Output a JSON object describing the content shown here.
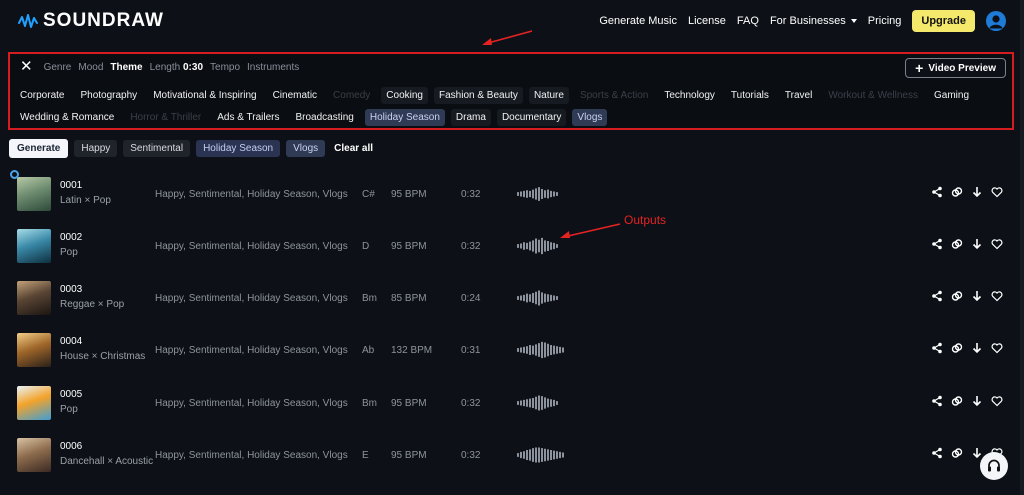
{
  "app": {
    "logo_text": "SOUNDRAW"
  },
  "nav": {
    "items": [
      {
        "label": "Generate Music"
      },
      {
        "label": "License"
      },
      {
        "label": "FAQ"
      },
      {
        "label": "For Businesses"
      },
      {
        "label": "Pricing"
      }
    ],
    "upgrade_label": "Upgrade"
  },
  "filters": {
    "tabs": [
      {
        "label": "Genre"
      },
      {
        "label": "Mood"
      },
      {
        "label": "Theme",
        "active": true
      },
      {
        "label": "Length",
        "value": "0:30"
      },
      {
        "label": "Tempo"
      },
      {
        "label": "Instruments"
      }
    ],
    "video_preview_label": "Video Preview",
    "theme_row_1": [
      {
        "label": "Corporate",
        "state": "normal"
      },
      {
        "label": "Photography",
        "state": "normal"
      },
      {
        "label": "Motivational & Inspiring",
        "state": "normal"
      },
      {
        "label": "Cinematic",
        "state": "normal"
      },
      {
        "label": "Comedy",
        "state": "disabled"
      },
      {
        "label": "Cooking",
        "state": "dark"
      },
      {
        "label": "Fashion & Beauty",
        "state": "dark"
      },
      {
        "label": "Nature",
        "state": "dark"
      },
      {
        "label": "Sports & Action",
        "state": "disabled"
      },
      {
        "label": "Technology",
        "state": "normal"
      },
      {
        "label": "Tutorials",
        "state": "normal"
      },
      {
        "label": "Travel",
        "state": "normal"
      },
      {
        "label": "Workout & Wellness",
        "state": "disabled"
      },
      {
        "label": "Gaming",
        "state": "normal"
      }
    ],
    "theme_row_2": [
      {
        "label": "Wedding & Romance",
        "state": "normal"
      },
      {
        "label": "Horror & Thriller",
        "state": "disabled"
      },
      {
        "label": "Ads & Trailers",
        "state": "normal"
      },
      {
        "label": "Broadcasting",
        "state": "normal"
      },
      {
        "label": "Holiday Season",
        "state": "selected"
      },
      {
        "label": "Drama",
        "state": "dark"
      },
      {
        "label": "Documentary",
        "state": "dark"
      },
      {
        "label": "Vlogs",
        "state": "selected"
      }
    ]
  },
  "actions": {
    "generate_label": "Generate",
    "selected_tags": [
      "Happy",
      "Sentimental",
      "Holiday Season",
      "Vlogs"
    ],
    "clear_all_label": "Clear all"
  },
  "annotation": {
    "outputs_label": "Outputs",
    "color": "#e52323"
  },
  "tracks": [
    {
      "id": "0001",
      "genre": "Latin × Pop",
      "moods": "Happy, Sentimental, Holiday Season, Vlogs",
      "key": "C#",
      "bpm": "95 BPM",
      "duration": "0:32",
      "art": [
        "#2e4a3a",
        "#6e8d70",
        "#b7c9a6"
      ],
      "playing": true
    },
    {
      "id": "0002",
      "genre": "Pop",
      "moods": "Happy, Sentimental, Holiday Season, Vlogs",
      "key": "D",
      "bpm": "95 BPM",
      "duration": "0:32",
      "art": [
        "#0e3040",
        "#3a89a8",
        "#a7dde8"
      ]
    },
    {
      "id": "0003",
      "genre": "Reggae × Pop",
      "moods": "Happy, Sentimental, Holiday Season, Vlogs",
      "key": "Bm",
      "bpm": "85 BPM",
      "duration": "0:24",
      "art": [
        "#1a1512",
        "#5a4534",
        "#c2a27a"
      ]
    },
    {
      "id": "0004",
      "genre": "House × Christmas",
      "moods": "Happy, Sentimental, Holiday Season, Vlogs",
      "key": "Ab",
      "bpm": "132 BPM",
      "duration": "0:31",
      "art": [
        "#2a2019",
        "#a0672a",
        "#f2cf87"
      ]
    },
    {
      "id": "0005",
      "genre": "Pop",
      "moods": "Happy, Sentimental, Holiday Season, Vlogs",
      "key": "Bm",
      "bpm": "95 BPM",
      "duration": "0:32",
      "art": [
        "#3e9ed6",
        "#f3a32a",
        "#e9f4f9"
      ]
    },
    {
      "id": "0006",
      "genre": "Dancehall × Acoustic",
      "moods": "Happy, Sentimental, Holiday Season, Vlogs",
      "key": "E",
      "bpm": "95 BPM",
      "duration": "0:32",
      "art": [
        "#3b2a22",
        "#8e6d4e",
        "#d8c3a3"
      ]
    }
  ],
  "colors": {
    "accent_yellow": "#f4e96a",
    "highlight_red": "#d51c20",
    "selected_chip": "#2f3a55"
  }
}
